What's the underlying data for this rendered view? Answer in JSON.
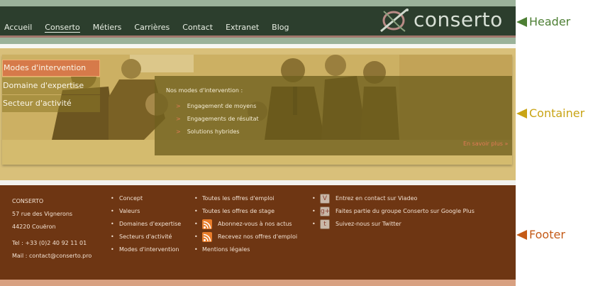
{
  "header": {
    "nav": [
      "Accueil",
      "Conserto",
      "Métiers",
      "Carrières",
      "Contact",
      "Extranet",
      "Blog"
    ],
    "logo_text": "conserto"
  },
  "container": {
    "menu": [
      "Modes d'intervention",
      "Domaine d'expertise",
      "Secteur d'activité"
    ],
    "intro": "Nos modes d'intervention :",
    "items": [
      "Engagement de moyens",
      "Engagements de résultat",
      "Solutions hybrides"
    ],
    "more_link": "En savoir plus »"
  },
  "footer": {
    "company": "CONSERTO",
    "address1": "57 rue des Vignerons",
    "address2": "44220 Couëron",
    "tel": "Tel : +33 (0)2 40 92 11 01",
    "mail": "Mail : contact@conserto.pro",
    "col2": [
      "Concept",
      "Valeurs",
      "Domaines d'expertise",
      "Secteurs d'activité",
      "Modes d'intervention"
    ],
    "col3a": [
      "Toutes les offres d'emploi",
      "Toutes les offres de stage"
    ],
    "col3b": [
      "Abonnez-vous à nos actus",
      "Recevez nos offres d'emploi"
    ],
    "col3c": "Mentions légales",
    "col4": [
      "Entrez en contact sur Viadeo",
      "Faites partie du groupe Conserto sur Google Plus",
      "Suivez-nous sur Twitter"
    ]
  },
  "callouts": {
    "header": "Header",
    "container": "Container",
    "footer": "Footer"
  },
  "colors": {
    "header_label": "#4d7f34",
    "container_label": "#c9a415",
    "footer_label": "#c45a17"
  },
  "icons": [
    "viadeo-icon",
    "google-plus-icon",
    "twitter-icon",
    "rss-icon"
  ]
}
